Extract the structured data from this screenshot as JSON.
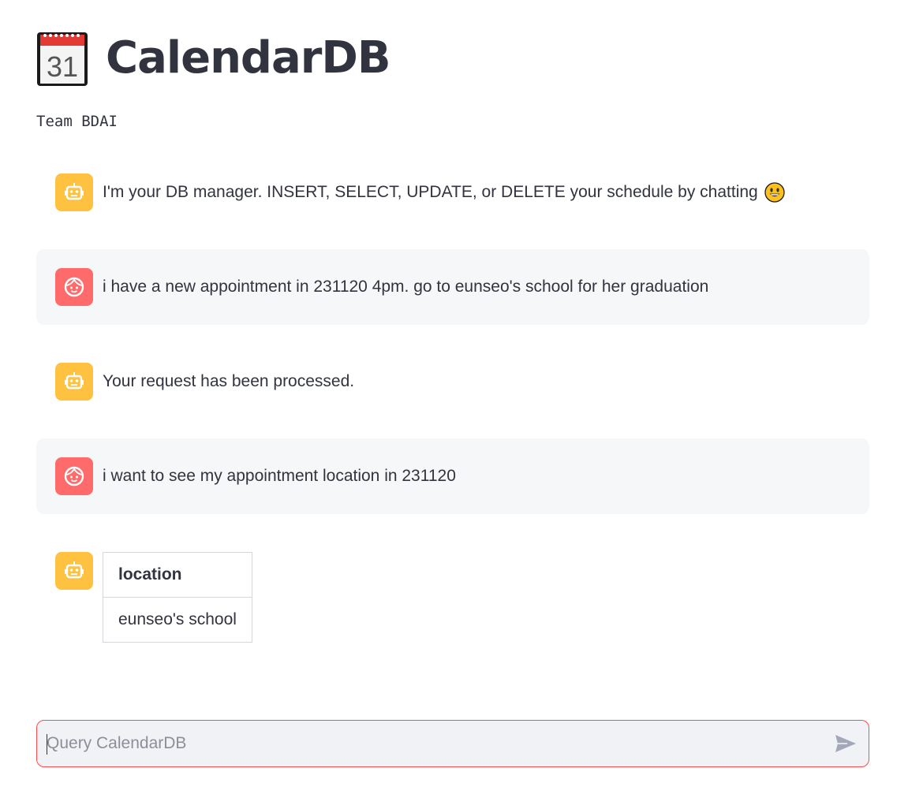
{
  "header": {
    "title": "CalendarDB",
    "icon": "calendar-icon",
    "calendar_day": "31",
    "subtitle": "Team BDAI"
  },
  "messages": [
    {
      "role": "assistant",
      "avatar_icon": "robot-icon",
      "text": "I'm your DB manager. INSERT, SELECT, UPDATE, or DELETE your schedule by chatting",
      "emoji": "grinning-face-icon"
    },
    {
      "role": "user",
      "avatar_icon": "user-face-icon",
      "text": "i have a new appointment in 231120 4pm. go to eunseo's school for her graduation"
    },
    {
      "role": "assistant",
      "avatar_icon": "robot-icon",
      "text": "Your request has been processed."
    },
    {
      "role": "user",
      "avatar_icon": "user-face-icon",
      "text": "i want to see my appointment location in 231120"
    },
    {
      "role": "assistant",
      "avatar_icon": "robot-icon",
      "table": {
        "columns": [
          "location"
        ],
        "rows": [
          [
            "eunseo's school"
          ]
        ]
      }
    }
  ],
  "chat_input": {
    "placeholder": "Query CalendarDB",
    "value": "",
    "send_icon": "send-icon"
  },
  "colors": {
    "assistant_avatar": "#ffc140",
    "user_avatar": "#ff6b6b",
    "user_message_bg": "#f6f7f9",
    "input_border_focus": "#ff4b4b",
    "text": "#31333f"
  }
}
